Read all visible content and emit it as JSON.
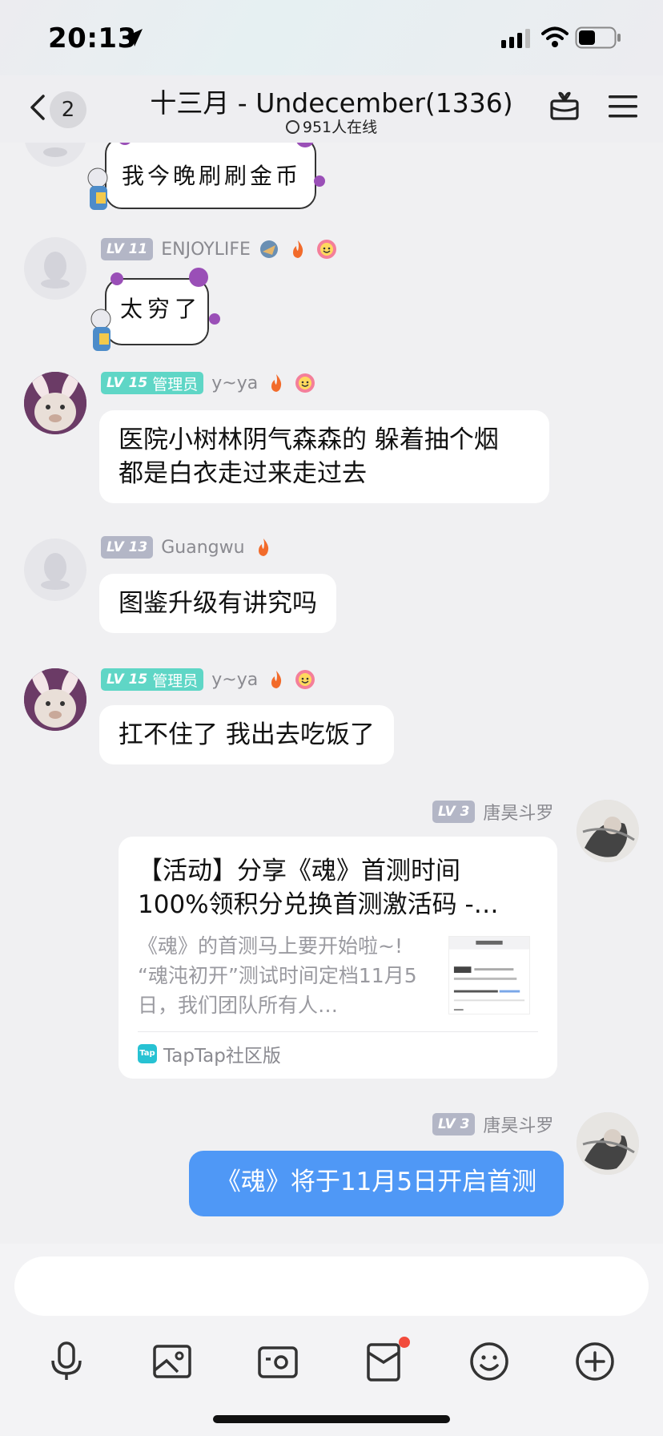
{
  "status_bar": {
    "time": "20:13"
  },
  "header": {
    "unread_count": "2",
    "group_title": "十三月 - Undecember(1336)",
    "online_text": "951人在线"
  },
  "messages": [
    {
      "type": "sticker",
      "text": "我今晚刷刷金币"
    },
    {
      "type": "sticker",
      "level": "LV 11",
      "name": "ENJOYLIFE",
      "text": "太穷了"
    },
    {
      "type": "text",
      "level": "LV 15",
      "role": "管理员",
      "name": "y~ya",
      "lines": [
        "医院小树林阴气森森的 躲着抽个烟",
        "都是白衣走过来走过去"
      ]
    },
    {
      "type": "text",
      "level": "LV 13",
      "name": "Guangwu",
      "text": "图鉴升级有讲究吗"
    },
    {
      "type": "text",
      "level": "LV 15",
      "role": "管理员",
      "name": "y~ya",
      "text": "扛不住了 我出去吃饭了"
    },
    {
      "type": "card",
      "level": "LV 3",
      "name": "唐昊斗罗",
      "title_lines": [
        "【活动】分享《魂》首测时间",
        "100%领积分兑换首测激活码 -…"
      ],
      "desc_lines": [
        "《魂》的首测马上要开始啦~!",
        "“魂沌初开”测试时间定档11月5",
        "日，我们团队所有人…"
      ],
      "source": "TapTap社区版",
      "logo_text": "Tap"
    },
    {
      "type": "text",
      "self_side": true,
      "level": "LV 3",
      "name": "唐昊斗罗",
      "text": "《魂》将于11月5日开启首测"
    }
  ]
}
